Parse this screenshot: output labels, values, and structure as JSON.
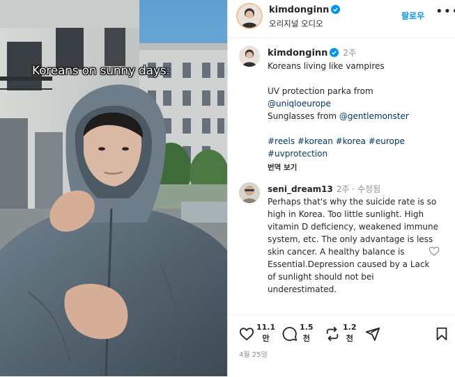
{
  "overlay_caption": "Koreans on sunny days:",
  "header": {
    "username": "kimdonginn",
    "audio_label": "오리지널 오디오",
    "follow_label": "팔로우",
    "more_label": "•••"
  },
  "caption": {
    "username": "kimdonginn",
    "time": "2주",
    "line1": "Koreans living like vampires",
    "line2": "UV protection parka from",
    "mention1": "@uniqloeurope",
    "line3_prefix": "Sunglasses from ",
    "mention2": "@gentlemonster",
    "hashtags_line1": "#reels #korean #korea #europe",
    "hashtags_line2": "#uvprotection",
    "translate_label": "번역 보기"
  },
  "comment": {
    "username": "seni_dream13",
    "time": "2주 · 수정됨",
    "text": "Perhaps that's why the suicide rate is so high in Korea. Too little sunlight. High vitamin D deficiency, weakened immune system, etc. The only advantage is less skin cancer. A healthy balance is Essential.Depression caused by a Lack of sunlight should not bei underestimated."
  },
  "actions": {
    "likes_num": "11.1",
    "likes_unit": "만",
    "comments_num": "1.5",
    "comments_unit": "천",
    "reposts_num": "1.2",
    "reposts_unit": "천"
  },
  "date": "4월 25일",
  "colors": {
    "verified": "#0095f6",
    "follow": "#0095f6",
    "link": "#00376b",
    "muted": "#8e8e8e"
  },
  "icons": [
    "verified-badge-icon",
    "heart-icon",
    "comment-icon",
    "repost-icon",
    "share-icon",
    "bookmark-icon",
    "more-icon"
  ]
}
